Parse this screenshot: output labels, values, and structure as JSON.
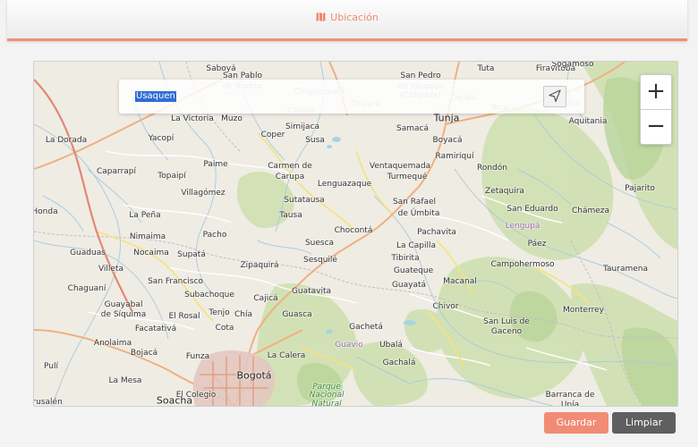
{
  "header": {
    "title": "Ubicación",
    "icon": "map-icon"
  },
  "search": {
    "value": "Usaquen",
    "locate_icon": "navigation-arrow-icon"
  },
  "zoom": {
    "in_label": "+",
    "out_label": "−"
  },
  "buttons": {
    "save": "Guardar",
    "clear": "Limpiar"
  },
  "colors": {
    "accent": "#f28b74",
    "clear_button": "#5f5f5f",
    "selection": "#2f6cd6"
  },
  "map": {
    "labels": [
      {
        "text": "Saboyá",
        "cls": ""
      },
      {
        "text": "Tuta",
        "cls": ""
      },
      {
        "text": "Firavitoba",
        "cls": ""
      },
      {
        "text": "Sogamoso",
        "cls": ""
      },
      {
        "text": "San Pablo",
        "cls": ""
      },
      {
        "text": "de Borbur",
        "cls": "faint"
      },
      {
        "text": "San Pedro",
        "cls": ""
      },
      {
        "text": "de Iguaque",
        "cls": "faint"
      },
      {
        "text": "(Chiquiza)",
        "cls": "faint"
      },
      {
        "text": "Chiquinquirá",
        "cls": "faint"
      },
      {
        "text": "Tinjacá",
        "cls": "faint"
      },
      {
        "text": "Oicatá",
        "cls": "faint"
      },
      {
        "text": "Caldas",
        "cls": "faint"
      },
      {
        "text": "Toca",
        "cls": "faint"
      },
      {
        "text": "Cuítiva",
        "cls": "faint"
      },
      {
        "text": "La Victoria",
        "cls": ""
      },
      {
        "text": "Muzo",
        "cls": ""
      },
      {
        "text": "Tunja",
        "cls": "big"
      },
      {
        "text": "Aquitania",
        "cls": ""
      },
      {
        "text": "Simijaca",
        "cls": ""
      },
      {
        "text": "Samacá",
        "cls": ""
      },
      {
        "text": "Coper",
        "cls": ""
      },
      {
        "text": "Susa",
        "cls": ""
      },
      {
        "text": "Boyacá",
        "cls": ""
      },
      {
        "text": "La Dorada",
        "cls": ""
      },
      {
        "text": "Yacopí",
        "cls": ""
      },
      {
        "text": "Ramiriquí",
        "cls": ""
      },
      {
        "text": "Paime",
        "cls": ""
      },
      {
        "text": "Carmen de",
        "cls": ""
      },
      {
        "text": "Carupa",
        "cls": ""
      },
      {
        "text": "Ventaquemada",
        "cls": ""
      },
      {
        "text": "Rondón",
        "cls": ""
      },
      {
        "text": "Caparrapí",
        "cls": ""
      },
      {
        "text": "Topaipí",
        "cls": ""
      },
      {
        "text": "Turmequé",
        "cls": ""
      },
      {
        "text": "Lenguazaque",
        "cls": ""
      },
      {
        "text": "Villagómez",
        "cls": ""
      },
      {
        "text": "Zetaquira",
        "cls": ""
      },
      {
        "text": "Pajarito",
        "cls": ""
      },
      {
        "text": "Sutatausa",
        "cls": ""
      },
      {
        "text": "San Rafael",
        "cls": ""
      },
      {
        "text": "de Úmbita",
        "cls": ""
      },
      {
        "text": "San Eduardo",
        "cls": ""
      },
      {
        "text": "Chámeza",
        "cls": ""
      },
      {
        "text": "Honda",
        "cls": ""
      },
      {
        "text": "La Peña",
        "cls": ""
      },
      {
        "text": "Tausa",
        "cls": ""
      },
      {
        "text": "Lengupá",
        "cls": "purple"
      },
      {
        "text": "Chocontá",
        "cls": ""
      },
      {
        "text": "Nimaima",
        "cls": ""
      },
      {
        "text": "Pacho",
        "cls": ""
      },
      {
        "text": "Pachavita",
        "cls": ""
      },
      {
        "text": "Suesca",
        "cls": ""
      },
      {
        "text": "Páez",
        "cls": ""
      },
      {
        "text": "La Capilla",
        "cls": ""
      },
      {
        "text": "Guaduas",
        "cls": ""
      },
      {
        "text": "Nocaima",
        "cls": ""
      },
      {
        "text": "Supatá",
        "cls": ""
      },
      {
        "text": "Tibirita",
        "cls": ""
      },
      {
        "text": "Sesquilé",
        "cls": ""
      },
      {
        "text": "Campohermoso",
        "cls": ""
      },
      {
        "text": "Villeta",
        "cls": ""
      },
      {
        "text": "Zipaquirá",
        "cls": ""
      },
      {
        "text": "Guateque",
        "cls": ""
      },
      {
        "text": "Tauramena",
        "cls": ""
      },
      {
        "text": "San Francisco",
        "cls": ""
      },
      {
        "text": "Macanal",
        "cls": ""
      },
      {
        "text": "Chaguaní",
        "cls": ""
      },
      {
        "text": "Guayatá",
        "cls": ""
      },
      {
        "text": "Subachoque",
        "cls": ""
      },
      {
        "text": "Cajicá",
        "cls": ""
      },
      {
        "text": "Guatavita",
        "cls": ""
      },
      {
        "text": "Guayabal",
        "cls": ""
      },
      {
        "text": "de Síquima",
        "cls": ""
      },
      {
        "text": "Chivor",
        "cls": ""
      },
      {
        "text": "Monterrey",
        "cls": ""
      },
      {
        "text": "Tenjo",
        "cls": ""
      },
      {
        "text": "El Rosal",
        "cls": ""
      },
      {
        "text": "Chía",
        "cls": ""
      },
      {
        "text": "Guasca",
        "cls": ""
      },
      {
        "text": "San Luis de",
        "cls": ""
      },
      {
        "text": "Gaceno",
        "cls": ""
      },
      {
        "text": "Facatativá",
        "cls": ""
      },
      {
        "text": "Cota",
        "cls": ""
      },
      {
        "text": "Gachetá",
        "cls": ""
      },
      {
        "text": "Anolaima",
        "cls": ""
      },
      {
        "text": "Guavio",
        "cls": "purple"
      },
      {
        "text": "Ubalá",
        "cls": ""
      },
      {
        "text": "Bojacá",
        "cls": ""
      },
      {
        "text": "Funza",
        "cls": ""
      },
      {
        "text": "La Calera",
        "cls": ""
      },
      {
        "text": "Gachalá",
        "cls": ""
      },
      {
        "text": "Pulí",
        "cls": ""
      },
      {
        "text": "Bogotá",
        "cls": "big"
      },
      {
        "text": "Parque",
        "cls": "green"
      },
      {
        "text": "Nacional",
        "cls": "green"
      },
      {
        "text": "Natural",
        "cls": "green"
      },
      {
        "text": "La Mesa",
        "cls": ""
      },
      {
        "text": "El Colegio",
        "cls": ""
      },
      {
        "text": "Soacha",
        "cls": "big"
      },
      {
        "text": "Jerusalén",
        "cls": ""
      },
      {
        "text": "Barranca de",
        "cls": ""
      },
      {
        "text": "Upía",
        "cls": ""
      }
    ]
  }
}
